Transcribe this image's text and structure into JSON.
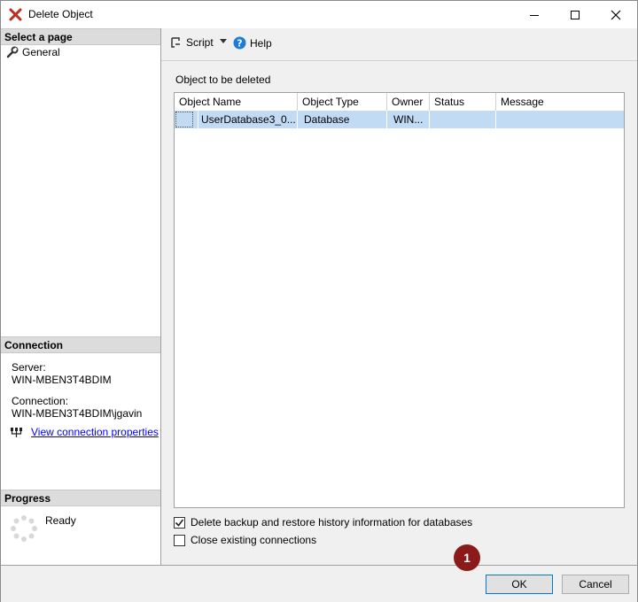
{
  "window": {
    "title": "Delete Object"
  },
  "left": {
    "select_page_header": "Select a page",
    "pages": [
      {
        "label": "General",
        "icon": "wrench-icon"
      }
    ],
    "connection_header": "Connection",
    "server_label": "Server:",
    "server_value": "WIN-MBEN3T4BDIM",
    "connection_label": "Connection:",
    "connection_value": "WIN-MBEN3T4BDIM\\jgavin",
    "view_connection_link": "View connection properties",
    "progress_header": "Progress",
    "progress_status": "Ready"
  },
  "toolbar": {
    "script_label": "Script",
    "help_label": "Help"
  },
  "main": {
    "object_label": "Object to be deleted",
    "columns": [
      "Object Name",
      "Object Type",
      "Owner",
      "Status",
      "Message"
    ],
    "rows": [
      {
        "name": "UserDatabase3_0...",
        "type": "Database",
        "owner": "WIN...",
        "status": "",
        "message": ""
      }
    ],
    "options": [
      {
        "label": "Delete backup and restore history information for databases",
        "checked": true
      },
      {
        "label": "Close existing connections",
        "checked": false
      }
    ]
  },
  "buttons": {
    "ok": "OK",
    "cancel": "Cancel"
  },
  "annotation": {
    "badge": "1"
  },
  "colors": {
    "accent": "#0078d7",
    "selection": "#c2dbf4",
    "badge": "#8b1a1a"
  }
}
